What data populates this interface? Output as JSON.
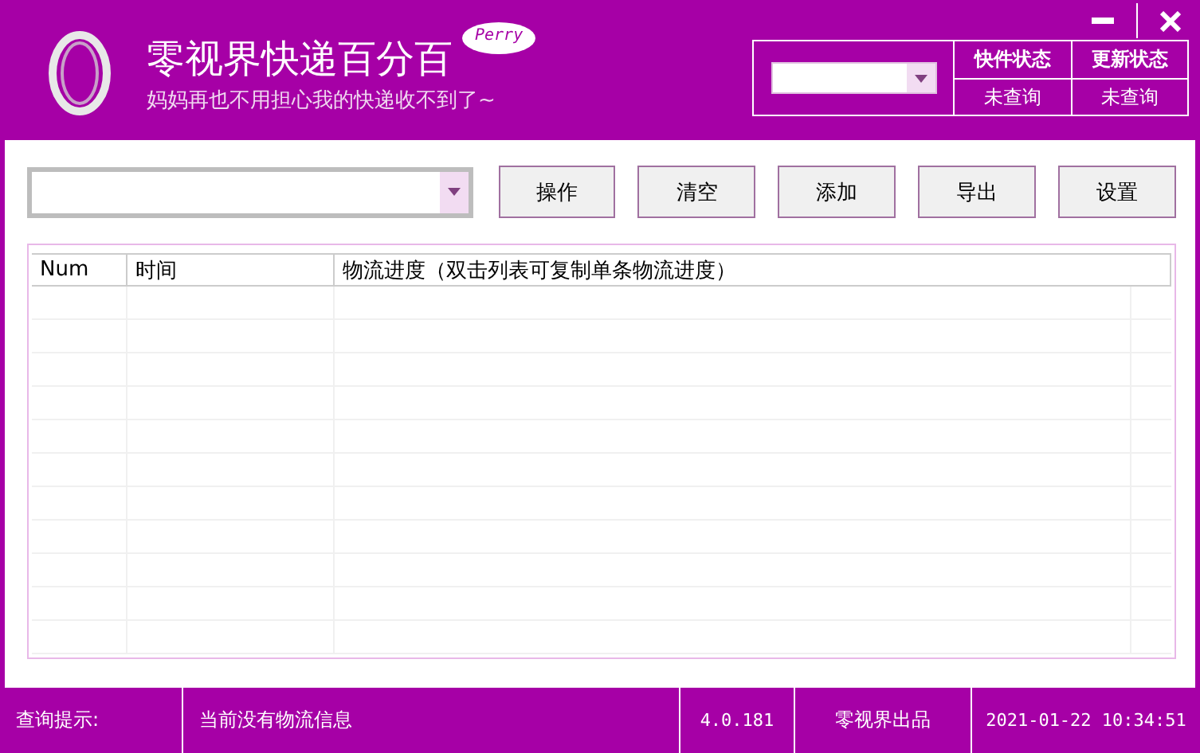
{
  "app": {
    "title": "零视界快递百分百",
    "badge": "Perry",
    "slogan": "妈妈再也不用担心我的快递收不到了~"
  },
  "status_panel": {
    "columns": [
      {
        "header": "快件状态",
        "value": "未查询"
      },
      {
        "header": "更新状态",
        "value": "未查询"
      }
    ]
  },
  "toolbar": {
    "buttons": [
      "操作",
      "清空",
      "添加",
      "导出",
      "设置"
    ]
  },
  "table": {
    "columns": [
      "Num",
      "时间",
      "物流进度（双击列表可复制单条物流进度）"
    ]
  },
  "status_bar": {
    "label": "查询提示:",
    "message": "当前没有物流信息",
    "version": "4.0.181",
    "credit": "零视界出品",
    "datetime": "2021-01-22 10:34:51"
  }
}
